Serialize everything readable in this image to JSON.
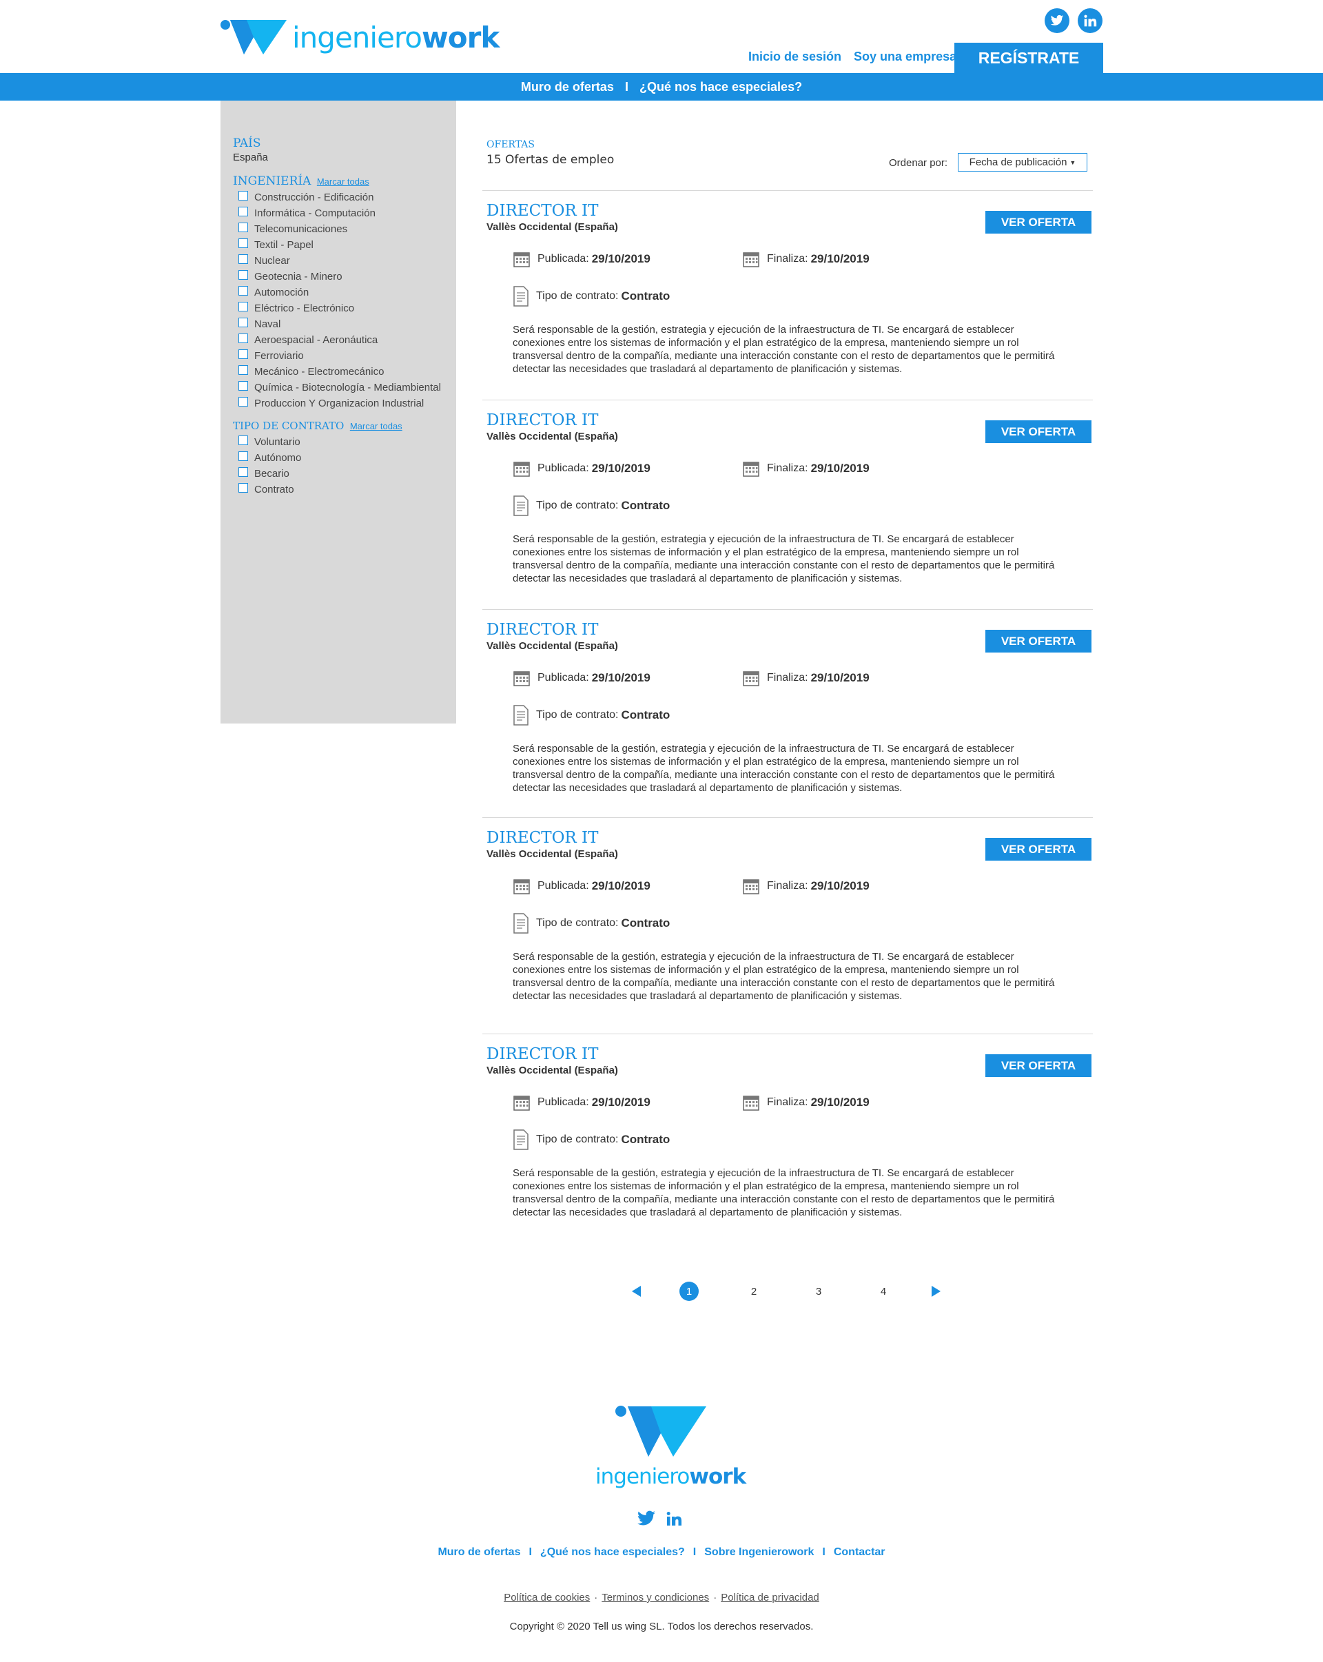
{
  "colors": {
    "brand_blue": "#1a8fe0",
    "brand_cyan": "#14b4f0",
    "sidebar_bg": "#d9d9d9"
  },
  "header": {
    "logo_part1": "ingeniero",
    "logo_part2": "work",
    "login_link": "Inicio de sesión",
    "company_link": "Soy una empresa",
    "register_button": "REGÍSTRATE",
    "social": [
      "twitter-icon",
      "linkedin-icon"
    ]
  },
  "nav": {
    "item1": "Muro de ofertas",
    "separator": "I",
    "item2": "¿Qué nos hace especiales?"
  },
  "sidebar": {
    "country_heading": "PAÍS",
    "country_value": "España",
    "engineering_heading": "INGENIERÍA",
    "engineering_mark_all": "Marcar todas",
    "engineering_items": [
      "Construcción - Edificación",
      "Informática - Computación",
      "Telecomunicaciones",
      "Textil - Papel",
      "Nuclear",
      "Geotecnia - Minero",
      "Automoción",
      "Eléctrico - Electrónico",
      "Naval",
      "Aeroespacial - Aeronáutica",
      "Ferroviario",
      "Mecánico - Electromecánico",
      "Química - Biotecnología - Mediambiental",
      "Produccion Y Organizacion Industrial"
    ],
    "contract_heading": "TIPO DE CONTRATO",
    "contract_mark_all": "Marcar todas",
    "contract_items": [
      "Voluntario",
      "Autónomo",
      "Becario",
      "Contrato"
    ]
  },
  "main": {
    "ofertas_label": "OFERTAS",
    "ofertas_count": "15 Ofertas de empleo",
    "order_label": "Ordenar por:",
    "order_value": "Fecha de publicación",
    "view_button": "VER OFERTA",
    "published_label": "Publicada:",
    "ends_label": "Finaliza:",
    "contract_label": "Tipo de contrato:",
    "jobs": [
      {
        "title": "DIRECTOR IT",
        "location": "Vallès Occidental (España)",
        "published": "29/10/2019",
        "ends": "29/10/2019",
        "contract": "Contrato",
        "description": "Será responsable de la gestión, estrategia y ejecución de la infraestructura de TI. Se encargará de establecer conexiones entre los sistemas de información y el plan estratégico de la empresa, manteniendo siempre un rol transversal dentro de la compañía, mediante una interacción constante con el resto de departamentos que le permitirá detectar las necesidades que trasladará al departamento de planificación y sistemas."
      },
      {
        "title": "DIRECTOR IT",
        "location": "Vallès Occidental (España)",
        "published": "29/10/2019",
        "ends": "29/10/2019",
        "contract": "Contrato",
        "description": "Será responsable de la gestión, estrategia y ejecución de la infraestructura de TI. Se encargará de establecer conexiones entre los sistemas de información y el plan estratégico de la empresa, manteniendo siempre un rol transversal dentro de la compañía, mediante una interacción constante con el resto de departamentos que le permitirá detectar las necesidades que trasladará al departamento de planificación y sistemas."
      },
      {
        "title": "DIRECTOR IT",
        "location": "Vallès Occidental (España)",
        "published": "29/10/2019",
        "ends": "29/10/2019",
        "contract": "Contrato",
        "description": "Será responsable de la gestión, estrategia y ejecución de la infraestructura de TI. Se encargará de establecer conexiones entre los sistemas de información y el plan estratégico de la empresa, manteniendo siempre un rol transversal dentro de la compañía, mediante una interacción constante con el resto de departamentos que le permitirá detectar las necesidades que trasladará al departamento de planificación y sistemas."
      },
      {
        "title": "DIRECTOR IT",
        "location": "Vallès Occidental (España)",
        "published": "29/10/2019",
        "ends": "29/10/2019",
        "contract": "Contrato",
        "description": "Será responsable de la gestión, estrategia y ejecución de la infraestructura de TI. Se encargará de establecer conexiones entre los sistemas de información y el plan estratégico de la empresa, manteniendo siempre un rol transversal dentro de la compañía, mediante una interacción constante con el resto de departamentos que le permitirá detectar las necesidades que trasladará al departamento de planificación y sistemas."
      },
      {
        "title": "DIRECTOR IT",
        "location": "Vallès Occidental (España)",
        "published": "29/10/2019",
        "ends": "29/10/2019",
        "contract": "Contrato",
        "description": "Será responsable de la gestión, estrategia y ejecución de la infraestructura de TI. Se encargará de establecer conexiones entre los sistemas de información y el plan estratégico de la empresa, manteniendo siempre un rol transversal dentro de la compañía, mediante una interacción constante con el resto de departamentos que le permitirá detectar las necesidades que trasladará al departamento de planificación y sistemas."
      }
    ]
  },
  "pagination": {
    "pages": [
      "1",
      "2",
      "3",
      "4"
    ],
    "current": "1"
  },
  "footer": {
    "logo_part1": "ingeniero",
    "logo_part2": "work",
    "links": [
      "Muro de ofertas",
      "¿Qué nos hace especiales?",
      "Sobre Ingenierowork",
      "Contactar"
    ],
    "separator": "I",
    "legal": [
      "Política de cookies",
      "Terminos y condiciones",
      "Política de privacidad"
    ],
    "legal_separator": "·",
    "copyright": "Copyright © 2020 Tell us wing SL. Todos los derechos reservados."
  }
}
